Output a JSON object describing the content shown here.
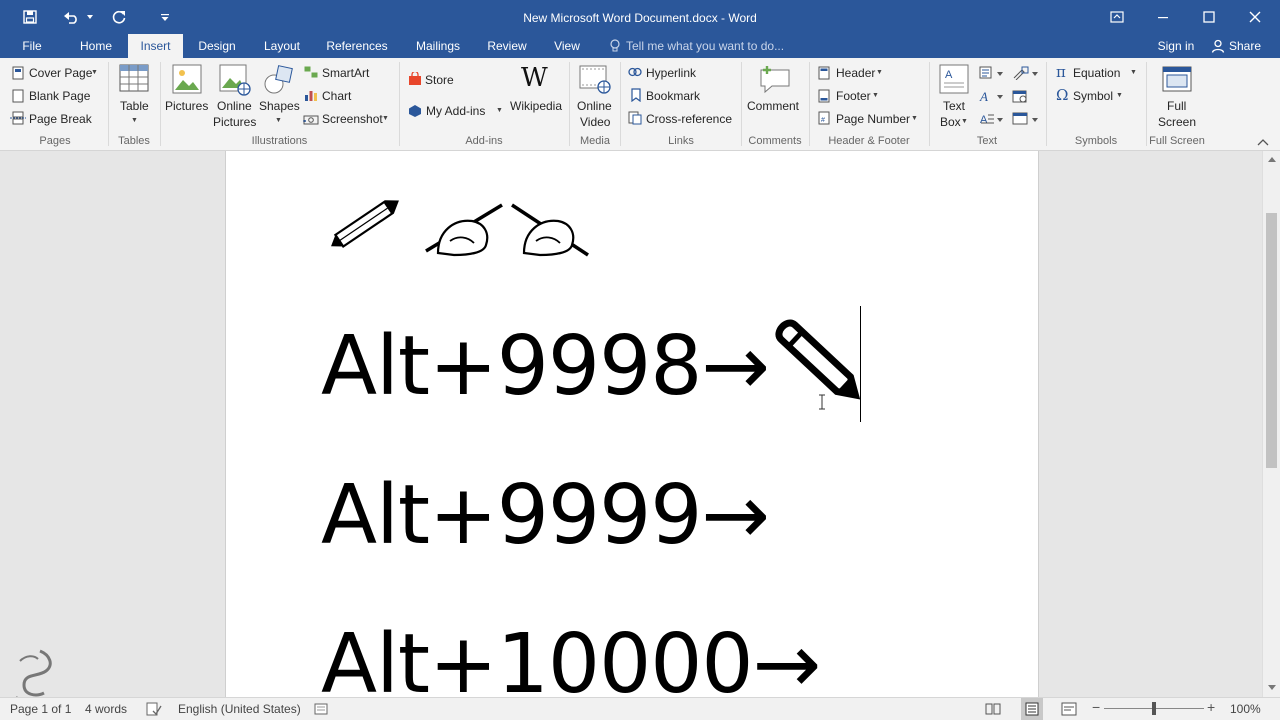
{
  "window": {
    "title": "New Microsoft Word Document.docx - Word",
    "accent_color": "#2b579a"
  },
  "quick_access": [
    "save-icon",
    "undo-icon",
    "redo-icon",
    "customize-icon"
  ],
  "tabs": {
    "file": "File",
    "home": "Home",
    "insert": "Insert",
    "design": "Design",
    "layout": "Layout",
    "references": "References",
    "mailings": "Mailings",
    "review": "Review",
    "view": "View",
    "tell_me": "Tell me what you want to do...",
    "sign_in": "Sign in",
    "share": "Share",
    "active": "Insert"
  },
  "ribbon": {
    "pages": {
      "cover_page": "Cover Page",
      "blank_page": "Blank Page",
      "page_break": "Page Break",
      "group": "Pages"
    },
    "tables": {
      "table": "Table",
      "group": "Tables"
    },
    "illustrations": {
      "pictures": "Pictures",
      "online_pictures_1": "Online",
      "online_pictures_2": "Pictures",
      "shapes": "Shapes",
      "smartart": "SmartArt",
      "chart": "Chart",
      "screenshot": "Screenshot",
      "group": "Illustrations"
    },
    "addins": {
      "store": "Store",
      "my_addins": "My Add-ins",
      "wikipedia": "Wikipedia",
      "group": "Add-ins"
    },
    "media": {
      "online_video_1": "Online",
      "online_video_2": "Video",
      "group": "Media"
    },
    "links": {
      "hyperlink": "Hyperlink",
      "bookmark": "Bookmark",
      "cross_reference": "Cross-reference",
      "group": "Links"
    },
    "comments": {
      "comment": "Comment",
      "group": "Comments"
    },
    "header_footer": {
      "header": "Header",
      "footer": "Footer",
      "page_number": "Page Number",
      "group": "Header & Footer"
    },
    "text": {
      "text_box_1": "Text",
      "text_box_2": "Box",
      "group": "Text"
    },
    "symbols": {
      "equation": "Equation",
      "symbol": "Symbol",
      "group": "Symbols"
    },
    "full_screen": {
      "label_1": "Full",
      "label_2": "Screen",
      "group": "Full Screen"
    }
  },
  "document": {
    "line1": "Alt+9998→",
    "line2": "Alt+9999→",
    "line3": "Alt+10000→"
  },
  "statusbar": {
    "page": "Page 1 of 1",
    "words": "4 words",
    "language": "English (United States)",
    "zoom": "100%",
    "zoom_fraction": 0.5
  }
}
